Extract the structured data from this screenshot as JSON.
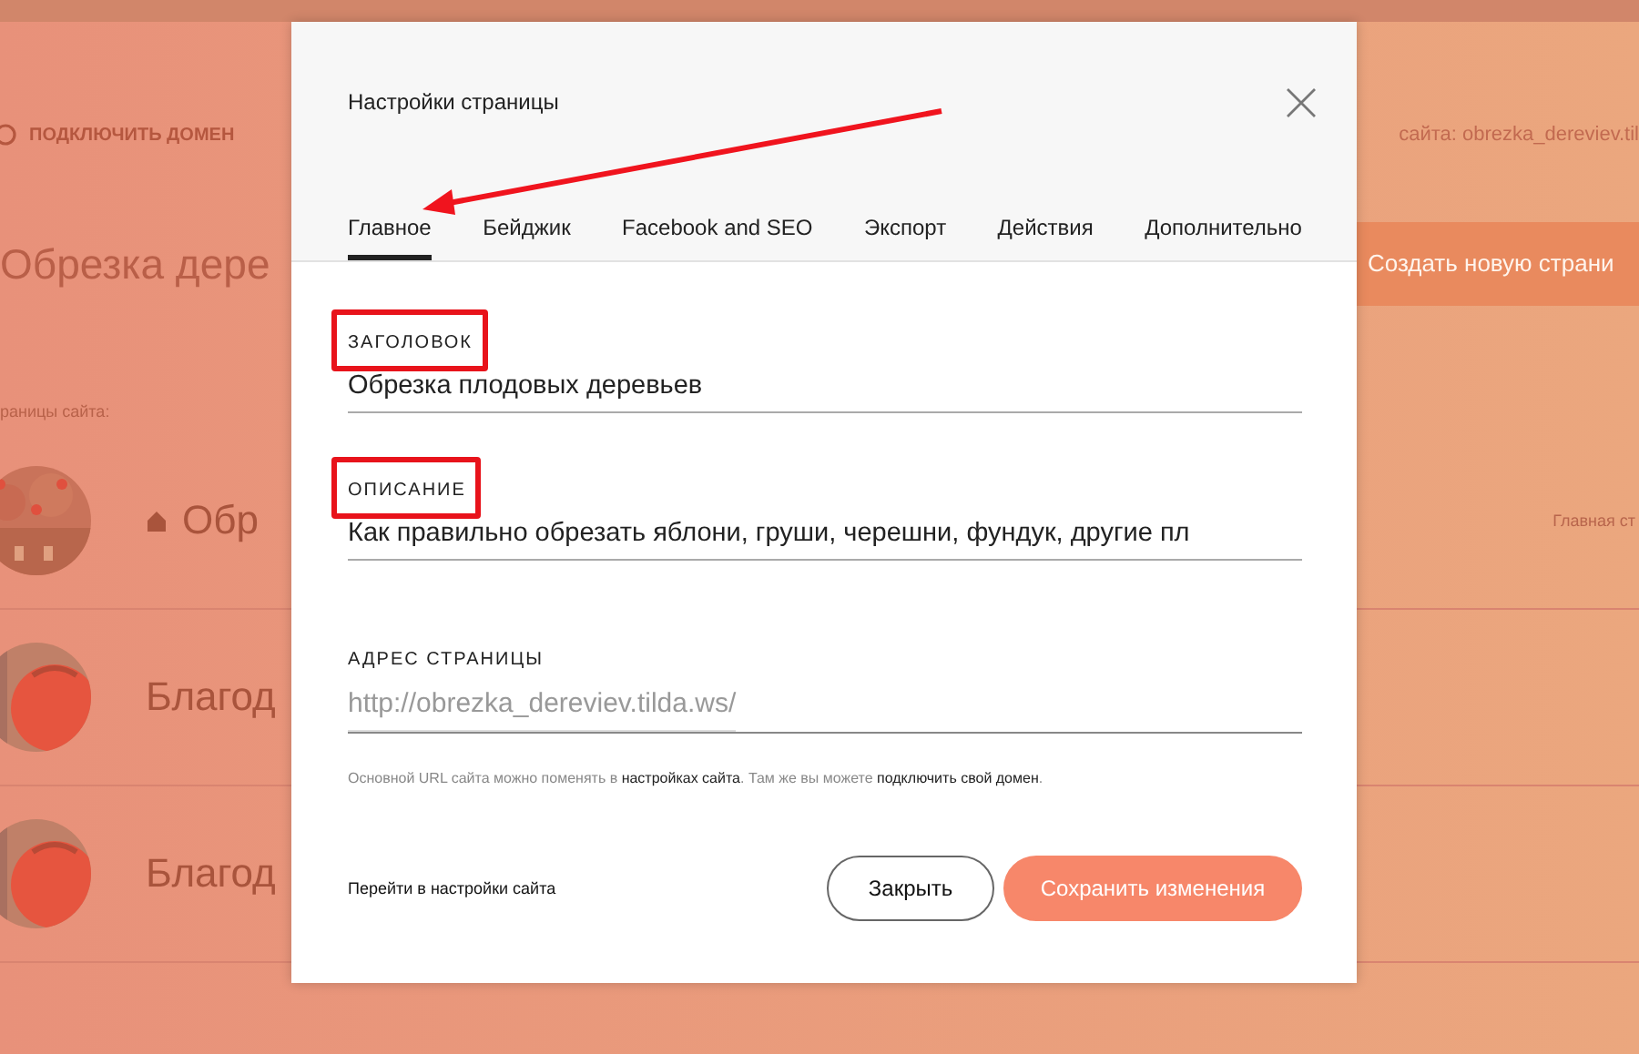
{
  "background_page": {
    "connect_domain": "ПОДКЛЮЧИТЬ ДОМЕН",
    "site_address": "сайта: obrezka_dereviev.til",
    "site_title": "Обрезка дере",
    "create_button": "Создать новую страни",
    "pages_label": "раницы сайта:",
    "pages": [
      {
        "title": "Обр",
        "home": true,
        "badge": "Главная ст"
      },
      {
        "title": "Благод",
        "home": false
      },
      {
        "title": "Благод",
        "home": false
      }
    ]
  },
  "dialog": {
    "title": "Настройки страницы",
    "tabs": [
      {
        "label": "Главное",
        "selected": true
      },
      {
        "label": "Бейджик",
        "selected": false
      },
      {
        "label": "Facebook and SEO",
        "selected": false
      },
      {
        "label": "Экспорт",
        "selected": false
      },
      {
        "label": "Действия",
        "selected": false
      },
      {
        "label": "Дополнительно",
        "selected": false
      }
    ],
    "fields": [
      {
        "label": "ЗАГОЛОВОК",
        "value": "Обрезка плодовых деревьев",
        "highlighted": true
      },
      {
        "label": "ОПИСАНИЕ",
        "value": "Как правильно обрезать яблони, груши, черешни, фундук, другие пл",
        "highlighted": true
      }
    ],
    "address": {
      "label": "АДРЕС СТРАНИЦЫ",
      "value": "http://obrezka_dereviev.tilda.ws/"
    },
    "hint": "Основной URL сайта можно поменять в **настройках сайта**. Там же вы можете **подключить свой домен**.",
    "footer_link": "Перейти в настройки сайта",
    "buttons": [
      {
        "label": "Закрыть",
        "kind": "secondary"
      },
      {
        "label": "Сохранить изменения",
        "kind": "primary"
      }
    ]
  }
}
